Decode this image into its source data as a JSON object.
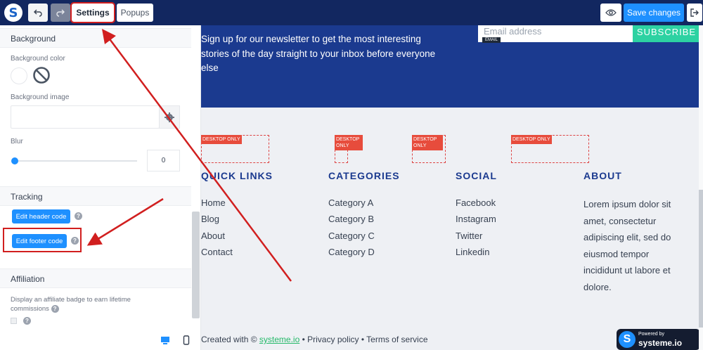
{
  "toolbar": {
    "logo_letter": "S",
    "settings_tab": "Settings",
    "popups_tab": "Popups",
    "save_label": "Save changes"
  },
  "sidebar": {
    "background_section": "Background",
    "background_color_label": "Background color",
    "background_image_label": "Background image",
    "blur_label": "Blur",
    "blur_value": "0",
    "blur_level": 0,
    "tracking_section": "Tracking",
    "edit_header_code": "Edit header code",
    "edit_footer_code": "Edit footer code",
    "affiliation_section": "Affiliation",
    "affiliation_text": "Display an affiliate badge to earn lifetime commissions",
    "help_glyph": "?"
  },
  "canvas": {
    "newsletter_text": "Sign up for our newsletter to get the most interesting stories of the day straight to your inbox before everyone else",
    "email_placeholder": "Email address",
    "subscribe_label": "SUBSCRIBE",
    "email_tag": "EMAIL",
    "desktop_only": "DESKTOP ONLY",
    "columns": [
      {
        "title": "QUICK LINKS",
        "links": [
          "Home",
          "Blog",
          "About",
          "Contact"
        ]
      },
      {
        "title": "CATEGORIES",
        "links": [
          "Category A",
          "Category B",
          "Category C",
          "Category D"
        ]
      },
      {
        "title": "SOCIAL",
        "links": [
          "Facebook",
          "Instagram",
          "Twitter",
          "Linkedin"
        ]
      },
      {
        "title": "ABOUT",
        "text": "Lorem ipsum dolor sit amet, consectetur adipiscing elit, sed do eiusmod tempor incididunt ut labore et dolore."
      }
    ],
    "footer": {
      "created_with": "Created with ©",
      "brand_link": "systeme.io",
      "separator": "•",
      "privacy": "Privacy policy",
      "terms": "Terms of service"
    },
    "badge": {
      "powered_by": "Powered by",
      "brand": "systeme.io"
    }
  },
  "colors": {
    "topbar": "#122760",
    "accent": "#1e90ff",
    "newsletter_bg": "#1b3a8f",
    "subscribe": "#2dd2a2",
    "annotation_red": "#d11f1f",
    "desktop_badge": "#e74c3c"
  },
  "icons": [
    "undo-icon",
    "redo-icon",
    "eye-icon",
    "exit-icon",
    "no-image-icon",
    "gear-icon",
    "desktop-icon",
    "mobile-icon"
  ]
}
